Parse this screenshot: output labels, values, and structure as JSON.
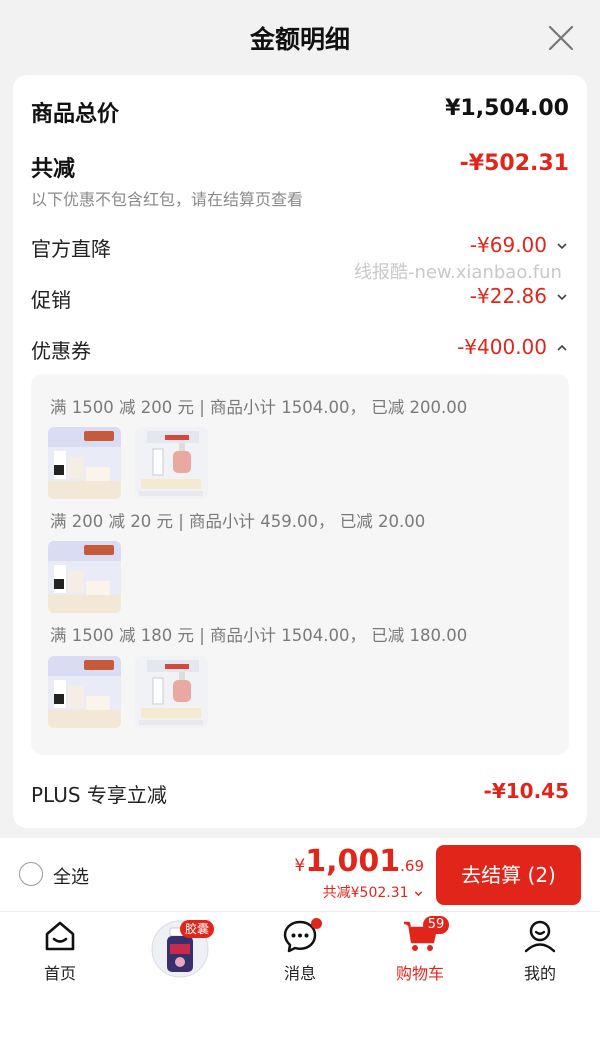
{
  "header": {
    "title": "金额明细"
  },
  "summary": {
    "goods_total_label": "商品总价",
    "goods_total_value": "¥1,504.00",
    "total_discount_label": "共减",
    "total_discount_value": "-¥502.31",
    "note": "以下优惠不包含红包，请在结算页查看"
  },
  "discounts": [
    {
      "label": "官方直降",
      "value": "-¥69.00",
      "expanded": false
    },
    {
      "label": "促销",
      "value": "-¥22.86",
      "expanded": false
    },
    {
      "label": "优惠券",
      "value": "-¥400.00",
      "expanded": true
    }
  ],
  "coupons": [
    {
      "text": "满 1500 减 200 元 | 商品小计 1504.00， 已减 200.00",
      "products": [
        "prona-product",
        "clinique-serum"
      ]
    },
    {
      "text": "满 200 减 20 元 | 商品小计 459.00， 已减 20.00",
      "products": [
        "prona-product"
      ]
    },
    {
      "text": "满 1500 减 180 元 | 商品小计 1504.00， 已减 180.00",
      "products": [
        "prona-product",
        "clinique-serum"
      ]
    }
  ],
  "plus": {
    "label": "PLUS 专享立减",
    "value": "-¥10.45"
  },
  "watermark": "线报酷-new.xianbao.fun",
  "checkout": {
    "select_all": "全选",
    "currency": "¥",
    "total_int": "1,001",
    "total_dec": ".69",
    "saving": "共减¥502.31",
    "button": "去结算 (2)"
  },
  "tabs": [
    {
      "label": "首页",
      "icon": "home-icon"
    },
    {
      "label": "",
      "icon": "capsule-product-icon",
      "badge": "胶囊"
    },
    {
      "label": "消息",
      "icon": "message-icon",
      "dot": true
    },
    {
      "label": "购物车",
      "icon": "cart-icon",
      "badge": "59",
      "active": true
    },
    {
      "label": "我的",
      "icon": "profile-icon"
    }
  ],
  "colors": {
    "accent": "#e1251b",
    "muted": "#8a8a8a",
    "background": "#f2f2f2"
  }
}
